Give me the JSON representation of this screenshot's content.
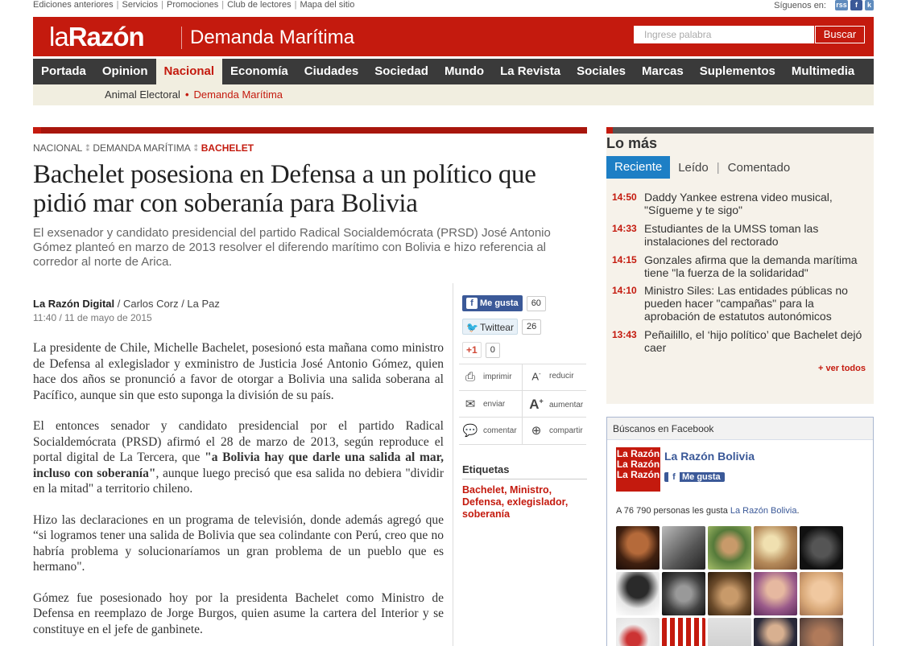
{
  "util": {
    "links": [
      "Ediciones anteriores",
      "Servicios",
      "Promociones",
      "Club de lectores",
      "Mapa del sitio"
    ],
    "follow_label": "Síguenos en:"
  },
  "header": {
    "logo_la": "la",
    "logo_razon": "Razón",
    "section": "Demanda Marítima",
    "search_placeholder": "Ingrese palabra",
    "search_button": "Buscar"
  },
  "nav": {
    "items": [
      "Portada",
      "Opinion",
      "Nacional",
      "Economía",
      "Ciudades",
      "Sociedad",
      "Mundo",
      "La Revista",
      "Sociales",
      "Marcas",
      "Suplementos",
      "Multimedia"
    ],
    "active": "Nacional"
  },
  "subnav": {
    "items": [
      "Animal Electoral",
      "Demanda Marítima"
    ]
  },
  "article": {
    "crumbs": [
      "NACIONAL",
      "DEMANDA MARÍTIMA",
      "BACHELET"
    ],
    "headline": "Bachelet posesiona en Defensa a un político que pidió mar con soberanía para Bolivia",
    "lead": "El exsenador y candidato presidencial del partido Radical Socialdemócrata (PRSD) José Antonio Gómez planteó en marzo de 2013 resolver el diferendo marítimo con Bolivia e hizo referencia al corredor al norte de Arica.",
    "source": "La Razón Digital",
    "byline_rest": " / Carlos Corz / La Paz",
    "date": "11:40 / 11 de mayo de 2015",
    "p1": "La presidente de Chile, Michelle Bachelet, posesionó esta mañana como ministro de Defensa al exlegislador y exministro de Justicia José Antonio Gómez, quien hace dos años se pronunció a favor de otorgar a Bolivia una salida soberana al Pacífico, aunque sin que esto suponga la división de su país.",
    "p2a": "El entonces senador y candidato presidencial por el partido Radical Socialdemócrata (PRSD) afirmó el 28 de marzo de 2013, según reproduce el portal digital de La Tercera, que ",
    "p2b": "\"a Bolivia hay que darle una salida al mar, incluso con soberanía\"",
    "p2c": ", aunque luego precisó que esa salida no debiera \"dividir en la mitad\" a territorio chileno.",
    "p3": "Hizo las declaraciones en un programa de televisión, donde además agregó que “si logramos tener una salida de Bolivia que sea colindante con Perú, creo que no habría problema y solucionaríamos un gran problema de un pueblo que es hermano\".",
    "p4": "Gómez fue posesionado hoy por la presidenta Bachelet como Ministro de Defensa en reemplazo de Jorge Burgos, quien asume la cartera del Interior y se constituye en el jefe de ganbinete."
  },
  "share": {
    "fb_label": "Me gusta",
    "fb_count": "60",
    "tw_label": "Twittear",
    "tw_count": "26",
    "gp_label": "+1",
    "gp_count": "0",
    "imprimir": "imprimir",
    "reducir": "reducir",
    "enviar": "enviar",
    "aumentar": "aumentar",
    "comentar": "comentar",
    "compartir": "compartir",
    "tags_title": "Etiquetas",
    "tags": "Bachelet, Ministro, Defensa, exlegislador, soberanía"
  },
  "lomas": {
    "title": "Lo más",
    "tabs": [
      "Reciente",
      "Leído",
      "Comentado"
    ],
    "news": [
      {
        "time": "14:50",
        "text": "Daddy Yankee estrena video musical, \"Sígueme y te sigo\""
      },
      {
        "time": "14:33",
        "text": "Estudiantes de la UMSS toman las instalaciones del rectorado"
      },
      {
        "time": "14:15",
        "text": "Gonzales afirma que la demanda marítima tiene \"la fuerza de la solidaridad\""
      },
      {
        "time": "14:10",
        "text": "Ministro Siles: Las entidades públicas no pueden hacer \"campañas\" para la aprobación de estatutos autonómicos"
      },
      {
        "time": "13:43",
        "text": "Peñailillo, el ‘hijo político’ que Bachelet dejó caer"
      }
    ],
    "ver_todos": "+ ver todos"
  },
  "facebook": {
    "head": "Búscanos en Facebook",
    "page_name": "La Razón Bolivia",
    "logo_text": "La Razón",
    "like": "Me gusta",
    "count_prefix": "A 76 790 personas les gusta ",
    "count_link": "La Razón Bolivia",
    "count_suffix": "."
  },
  "colors": {
    "brand_red": "#c41a0e",
    "nav_dark": "#3a3a3a",
    "tab_blue": "#1d7fc5",
    "fb_blue": "#3b5998"
  }
}
